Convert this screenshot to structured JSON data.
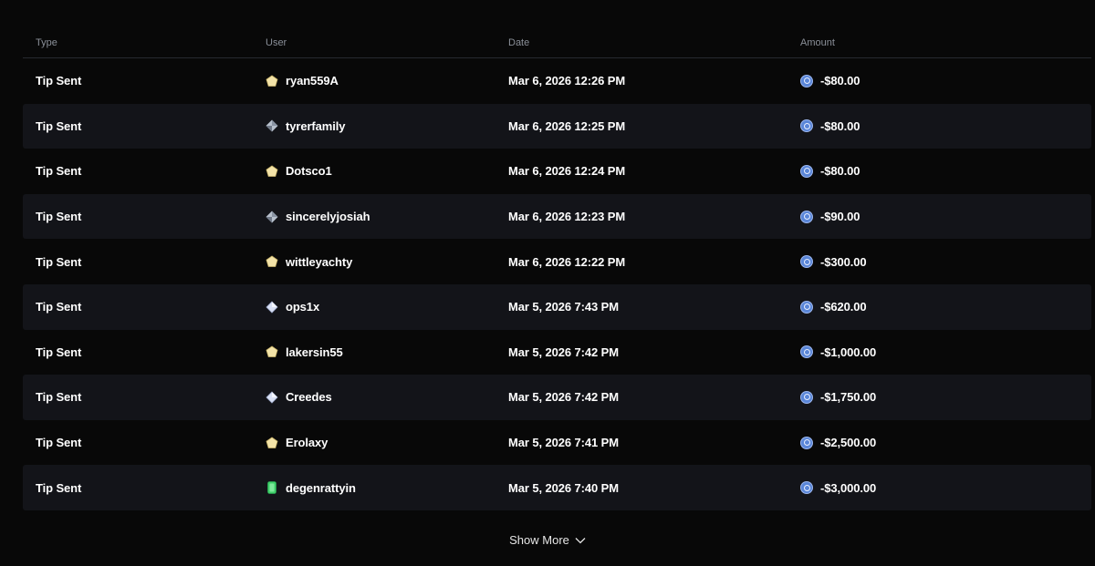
{
  "header": {
    "type": "Type",
    "user": "User",
    "date": "Date",
    "amount": "Amount"
  },
  "rows": [
    {
      "type": "Tip Sent",
      "rank": "gold",
      "user": "ryan559A",
      "date": "Mar 6, 2026 12:26 PM",
      "amount": "-$80.00"
    },
    {
      "type": "Tip Sent",
      "rank": "platinum",
      "user": "tyrerfamily",
      "date": "Mar 6, 2026 12:25 PM",
      "amount": "-$80.00"
    },
    {
      "type": "Tip Sent",
      "rank": "gold",
      "user": "Dotsco1",
      "date": "Mar 6, 2026 12:24 PM",
      "amount": "-$80.00"
    },
    {
      "type": "Tip Sent",
      "rank": "platinum",
      "user": "sincerelyjosiah",
      "date": "Mar 6, 2026 12:23 PM",
      "amount": "-$90.00"
    },
    {
      "type": "Tip Sent",
      "rank": "gold",
      "user": "wittleyachty",
      "date": "Mar 6, 2026 12:22 PM",
      "amount": "-$300.00"
    },
    {
      "type": "Tip Sent",
      "rank": "diamond",
      "user": "ops1x",
      "date": "Mar 5, 2026 7:43 PM",
      "amount": "-$620.00"
    },
    {
      "type": "Tip Sent",
      "rank": "gold",
      "user": "lakersin55",
      "date": "Mar 5, 2026 7:42 PM",
      "amount": "-$1,000.00"
    },
    {
      "type": "Tip Sent",
      "rank": "diamond",
      "user": "Creedes",
      "date": "Mar 5, 2026 7:42 PM",
      "amount": "-$1,750.00"
    },
    {
      "type": "Tip Sent",
      "rank": "gold",
      "user": "Erolaxy",
      "date": "Mar 5, 2026 7:41 PM",
      "amount": "-$2,500.00"
    },
    {
      "type": "Tip Sent",
      "rank": "emerald",
      "user": "degenrattyin",
      "date": "Mar 5, 2026 7:40 PM",
      "amount": "-$3,000.00"
    }
  ],
  "show_more_label": "Show More",
  "colors": {
    "gold": "#f3e3a8",
    "platinum": "#b7c0cc",
    "diamond": "#d9e1f5",
    "emerald": "#3fcf6a",
    "coin": "#5a86d8"
  }
}
